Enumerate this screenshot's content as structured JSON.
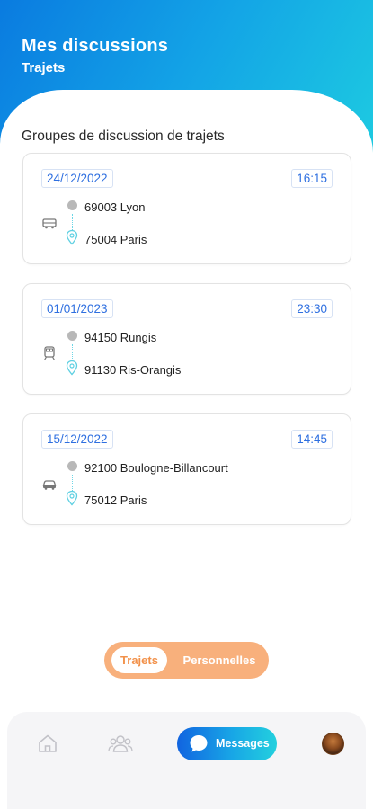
{
  "header": {
    "title": "Mes discussions",
    "subtitle": "Trajets"
  },
  "section": {
    "title": "Groupes de discussion de trajets"
  },
  "trips": [
    {
      "date": "24/12/2022",
      "time": "16:15",
      "from": "69003 Lyon",
      "to": "75004 Paris",
      "vehicle_icon": "bus-icon"
    },
    {
      "date": "01/01/2023",
      "time": "23:30",
      "from": "94150 Rungis",
      "to": "91130 Ris-Orangis",
      "vehicle_icon": "train-icon"
    },
    {
      "date": "15/12/2022",
      "time": "14:45",
      "from": "92100 Boulogne-Billancourt",
      "to": "75012 Paris",
      "vehicle_icon": "car-icon"
    }
  ],
  "toggle": {
    "active_label": "Trajets",
    "inactive_label": "Personnelles"
  },
  "nav": {
    "home_icon": "home-icon",
    "groups_icon": "groups-icon",
    "messages_label": "Messages",
    "profile_icon": "avatar"
  },
  "colors": {
    "gradient_start": "#0a7be0",
    "gradient_end": "#1fd2e0",
    "badge_text": "#2e6fe0",
    "toggle_bg": "#f8b07c",
    "toggle_active_text": "#f2914a",
    "route_line": "#6dd6e6"
  }
}
